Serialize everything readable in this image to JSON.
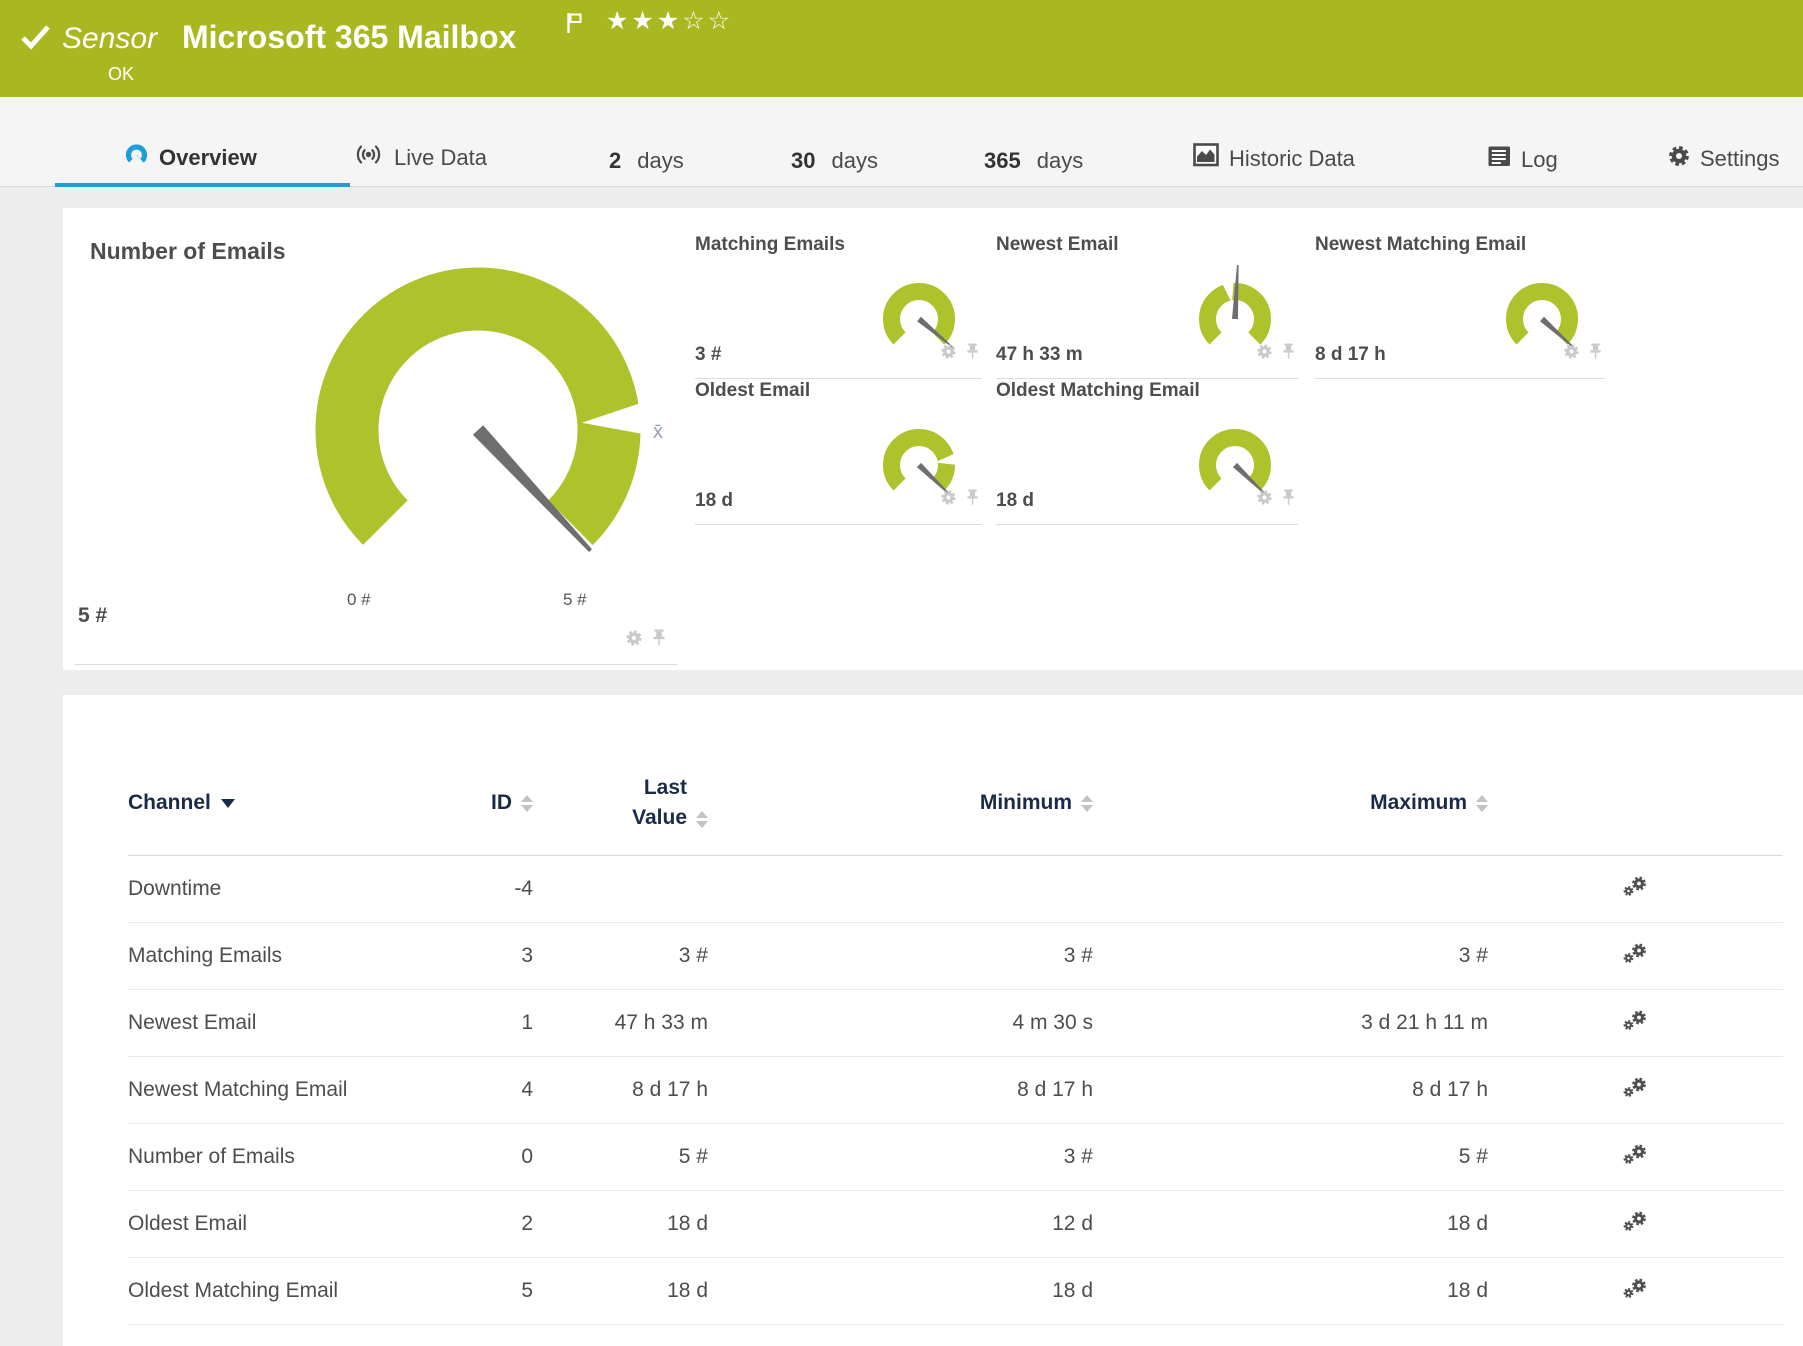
{
  "colors": {
    "header_green": "#a9b820",
    "gauge_green": "#aec22b",
    "blue": "#1f9dd9",
    "navy": "#1a2b4a"
  },
  "header": {
    "kind": "Sensor",
    "title": "Microsoft 365 Mailbox",
    "status": "OK",
    "stars_filled": "★★★",
    "stars_empty": "☆☆"
  },
  "tabs": {
    "overview": "Overview",
    "live": "Live Data",
    "d2": {
      "value": "2",
      "unit": "days"
    },
    "d30": {
      "value": "30",
      "unit": "days"
    },
    "d365": {
      "value": "365",
      "unit": "days"
    },
    "historic": "Historic Data",
    "log": "Log",
    "settings": "Settings"
  },
  "chart_data": {
    "type": "gauge-set",
    "gauges": [
      {
        "title": "Number of Emails",
        "value": "5 #",
        "min": "0 #",
        "max": "5 #"
      },
      {
        "title": "Matching Emails",
        "value": "3 #"
      },
      {
        "title": "Newest Email",
        "value": "47 h 33 m"
      },
      {
        "title": "Newest Matching Email",
        "value": "8 d 17 h"
      },
      {
        "title": "Oldest Email",
        "value": "18 d"
      },
      {
        "title": "Oldest Matching Email",
        "value": "18 d"
      }
    ]
  },
  "gauges": {
    "main": {
      "title": "Number of Emails",
      "value": "5 #",
      "min_label": "0 #",
      "max_label": "5 #",
      "avg_label": "x̄",
      "needle_deg": 47,
      "notch_deg": -4
    },
    "small": [
      {
        "title": "Matching Emails",
        "value": "3 #",
        "needle_deg": 40
      },
      {
        "title": "Newest Email",
        "value": "47 h 33 m",
        "needle_deg": -87,
        "needle_len": 54,
        "notch_deg": -101
      },
      {
        "title": "Newest Matching Email",
        "value": "8 d 17 h",
        "needle_deg": 42
      },
      {
        "title": "Oldest Email",
        "value": "18 d",
        "needle_deg": 44,
        "notch_deg": -9
      },
      {
        "title": "Oldest Matching Email",
        "value": "18 d",
        "needle_deg": 44
      }
    ]
  },
  "table": {
    "col_channel": "Channel",
    "col_id": "ID",
    "col_last": "Last Value",
    "col_min": "Minimum",
    "col_max": "Maximum",
    "rows": [
      {
        "channel": "Downtime",
        "id": "-4",
        "last": "",
        "min": "",
        "max": ""
      },
      {
        "channel": "Matching Emails",
        "id": "3",
        "last": "3 #",
        "min": "3 #",
        "max": "3 #"
      },
      {
        "channel": "Newest Email",
        "id": "1",
        "last": "47 h 33 m",
        "min": "4 m 30 s",
        "max": "3 d 21 h 11 m"
      },
      {
        "channel": "Newest Matching Email",
        "id": "4",
        "last": "8 d 17 h",
        "min": "8 d 17 h",
        "max": "8 d 17 h"
      },
      {
        "channel": "Number of Emails",
        "id": "0",
        "last": "5 #",
        "min": "3 #",
        "max": "5 #"
      },
      {
        "channel": "Oldest Email",
        "id": "2",
        "last": "18 d",
        "min": "12 d",
        "max": "18 d"
      },
      {
        "channel": "Oldest Matching Email",
        "id": "5",
        "last": "18 d",
        "min": "18 d",
        "max": "18 d"
      }
    ]
  }
}
